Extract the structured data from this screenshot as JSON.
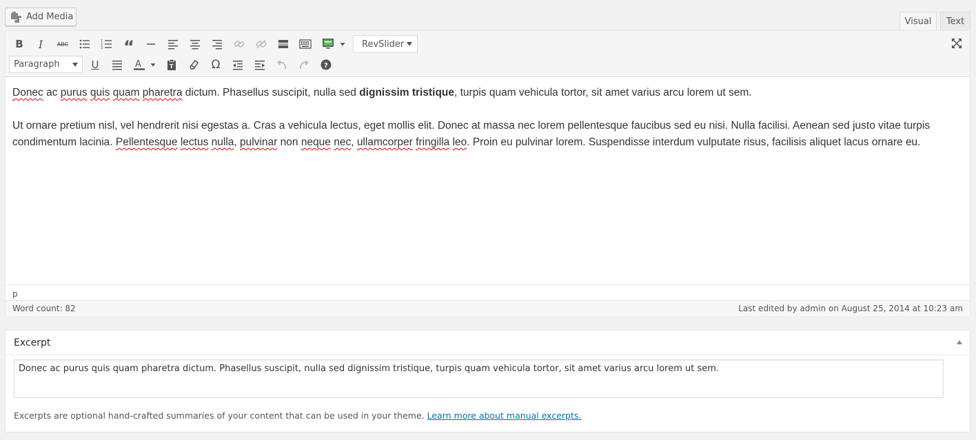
{
  "add_media": {
    "label": "Add Media",
    "icon": "camera-music-icon"
  },
  "tabs": [
    {
      "label": "Visual",
      "active": true
    },
    {
      "label": "Text",
      "active": false
    }
  ],
  "toolbar": {
    "row1_icons": [
      "bold-icon",
      "italic-icon",
      "strikethrough-icon",
      "bullet-list-icon",
      "numbered-list-icon",
      "blockquote-icon",
      "horizontal-rule-icon",
      "align-left-icon",
      "align-center-icon",
      "align-right-icon",
      "insert-link-icon",
      "remove-link-icon",
      "read-more-icon",
      "toolbar-toggle-icon",
      "slider-icon"
    ],
    "revslider_label": "RevSlider",
    "format_select_value": "Paragraph",
    "row2_icons": [
      "underline-icon",
      "justify-icon",
      "text-color-icon",
      "paste-text-icon",
      "clear-formatting-icon",
      "special-character-icon",
      "outdent-icon",
      "indent-icon",
      "undo-icon",
      "redo-icon",
      "help-icon"
    ],
    "fullscreen_icon": "fullscreen-icon"
  },
  "content": {
    "p1": {
      "w1": "Donec",
      "t1": " ac ",
      "w2": "purus",
      "t2": " ",
      "w3": "quis",
      "t3": " ",
      "w4": "quam",
      "t4": " ",
      "w5": "pharetra",
      "t5": " dictum. Phasellus suscipit, nulla sed ",
      "bold": "dignissim tristique",
      "t6": ", turpis quam vehicula tortor, sit amet varius arcu lorem ut sem."
    },
    "p2": {
      "t1": "Ut ornare pretium nisl, vel hendrerit nisi egestas a. Cras a vehicula lectus, eget mollis elit. Donec at massa nec lorem pellentesque faucibus sed eu nisi. Nulla facilisi. Aenean sed justo vitae turpis condimentum lacinia. ",
      "w1": "Pellentesque",
      "t2": " ",
      "w2": "lectus",
      "t3": " ",
      "w3": "nulla",
      "t4": ", ",
      "w4": "pulvinar",
      "t5": " non ",
      "w5": "neque",
      "t6": " ",
      "w6": "nec",
      "t7": ", ",
      "w7": "ullamcorper",
      "t8": " ",
      "w8": "fringilla",
      "t9": " ",
      "w9": "leo",
      "t10": ". Proin eu pulvinar lorem. Suspendisse interdum vulputate risus, facilisis aliquet lacus ornare eu."
    }
  },
  "path": "p",
  "status": {
    "word_count": "Word count: 82",
    "last_edited": "Last edited by admin on August 25, 2014 at 10:23 am"
  },
  "excerpt": {
    "title": "Excerpt",
    "value": "Donec ac purus quis quam pharetra dictum. Phasellus suscipit, nulla sed dignissim tristique, turpis quam vehicula tortor, sit amet varius arcu lorem ut sem.",
    "note": "Excerpts are optional hand-crafted summaries of your content that can be used in your theme.",
    "link": "Learn more about manual excerpts."
  },
  "colors": {
    "link": "#0073aa",
    "spellcheck": "#d00",
    "toolbar_bg": "#f5f5f5"
  }
}
